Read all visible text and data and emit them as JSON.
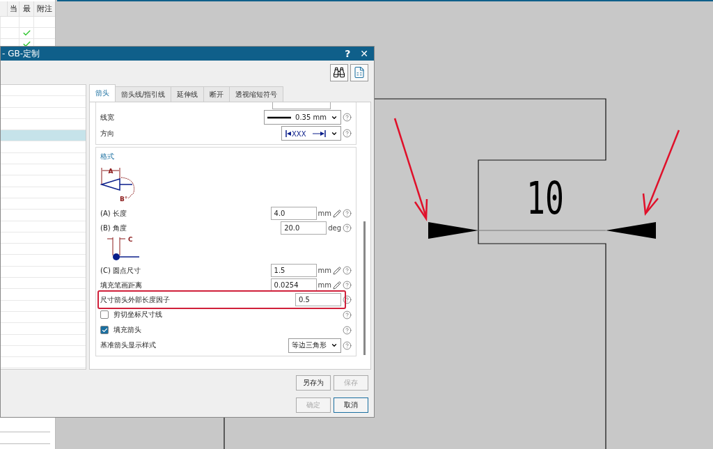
{
  "nav_table": {
    "columns": [
      "当",
      "最",
      "附注"
    ],
    "rows": [
      {
        "checked": false
      },
      {
        "checked": true
      },
      {
        "checked": true
      }
    ]
  },
  "drawing": {
    "dimension_text": "10"
  },
  "dialog": {
    "title": "- GB-定制",
    "help_button": "?",
    "close_button": "✕",
    "list": {
      "rows": [
        {
          "selected": false
        },
        {
          "selected": false
        },
        {
          "selected": false
        },
        {
          "selected": false
        },
        {
          "selected": true
        },
        {
          "selected": false
        },
        {
          "selected": false
        },
        {
          "selected": false
        },
        {
          "selected": false
        },
        {
          "selected": false
        },
        {
          "selected": false
        },
        {
          "selected": false
        },
        {
          "selected": false
        },
        {
          "selected": false
        },
        {
          "selected": false
        },
        {
          "selected": false
        },
        {
          "selected": false
        },
        {
          "selected": false
        },
        {
          "selected": false
        },
        {
          "selected": false
        },
        {
          "selected": false
        },
        {
          "selected": false
        },
        {
          "selected": false
        },
        {
          "selected": false
        },
        {
          "selected": false
        }
      ]
    },
    "tabs": [
      {
        "label": "箭头",
        "selected": true
      },
      {
        "label": "箭头线/指引线",
        "selected": false
      },
      {
        "label": "延伸线",
        "selected": false
      },
      {
        "label": "断开",
        "selected": false
      },
      {
        "label": "透视缩短符号",
        "selected": false
      }
    ],
    "line_group": {
      "rows": [
        {
          "kind": "line_width",
          "label": "线宽",
          "value": "0.35 mm"
        },
        {
          "kind": "direction",
          "label": "方向",
          "sample": "XXX"
        }
      ]
    },
    "format": {
      "title": "格式",
      "rows": [
        {
          "kind": "arrow_diagram",
          "labels": [
            "A",
            "B°"
          ]
        },
        {
          "kind": "field",
          "label": "(A) 长度",
          "value": "4.0",
          "unit": "mm",
          "pencil": true,
          "highlighted": false
        },
        {
          "kind": "field",
          "label": "(B) 角度",
          "value": "20.0",
          "unit": "deg",
          "pencil": false,
          "highlighted": false
        },
        {
          "kind": "dot_diagram",
          "labels": [
            "C"
          ]
        },
        {
          "kind": "field",
          "label": "(C) 圆点尺寸",
          "value": "1.5",
          "unit": "mm",
          "pencil": true,
          "highlighted": false
        },
        {
          "kind": "field",
          "label": "填充笔画距离",
          "value": "0.0254",
          "unit": "mm",
          "pencil": true,
          "highlighted": false
        },
        {
          "kind": "field",
          "label": "尺寸箭头外部长度因子",
          "value": "0.5",
          "pencil": false,
          "highlighted": true
        },
        {
          "kind": "checkbox",
          "label": "剪切坐标尺寸线",
          "checked": false
        },
        {
          "kind": "checkbox",
          "label": "填充箭头",
          "checked": true
        },
        {
          "kind": "dropdown",
          "label": "基准箭头显示样式",
          "value": "等边三角形"
        }
      ]
    },
    "button_rows": [
      [
        {
          "label": "另存为",
          "disabled": false,
          "focused": false
        },
        {
          "label": "保存",
          "disabled": true,
          "focused": false
        }
      ],
      [
        {
          "label": "确定",
          "disabled": true,
          "focused": false
        },
        {
          "label": "取消",
          "disabled": false,
          "focused": true
        }
      ]
    ]
  }
}
